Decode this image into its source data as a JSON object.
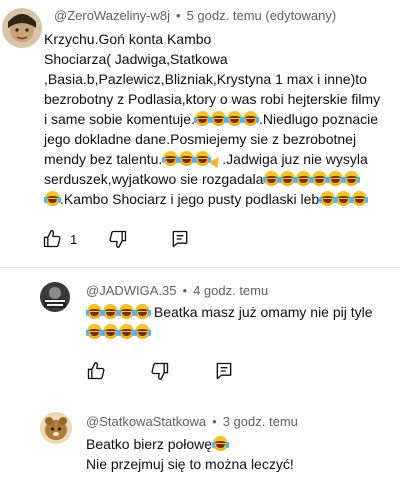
{
  "comments": [
    {
      "author": "@ZeroWazeliny-w8j",
      "time": "5 godz. temu (edytowany)",
      "lines": [
        "Krzychu.Goń konta Kambo",
        "Shociarza( Jadwiga,Statkowa",
        ",Basia.b,Pazlewicz,Blizniak,Krystyna 1 max i inne)to",
        "bezrobotny z Podlasia,ktory o was robi hejterskie filmy",
        "i same sobie komentuje.",
        ".Niedlugo poznacie",
        "jego dokladne dane.Posmiejemy sie z bezrobotnej",
        "mendy bez talentu.",
        ".Jadwiga juz nie wysyla",
        "serduszek,wyjatkowo sie rozgadala",
        ".Kambo Shociarz i jego pusty podlaski leb"
      ],
      "likes": "1",
      "avatar_color": "#c9a27a"
    },
    {
      "author": "@JADWIGA.35",
      "time": "4 godz. temu",
      "lines": [
        "Beatka masz już omamy  nie pij tyle"
      ],
      "avatar_text": "NIE ma CZEGO NIE MA WSTĘPU",
      "avatar_color": "#3a3a3a"
    },
    {
      "author": "@StatkowaStatkowa",
      "time": "3 godz. temu",
      "lines": [
        "Beatko bierz połowę",
        "Nie przejmuj się to można leczyć!"
      ],
      "avatar_color": "#b07a3a"
    }
  ],
  "icons": [
    "thumb-up-icon",
    "thumb-down-icon",
    "reply-icon"
  ]
}
